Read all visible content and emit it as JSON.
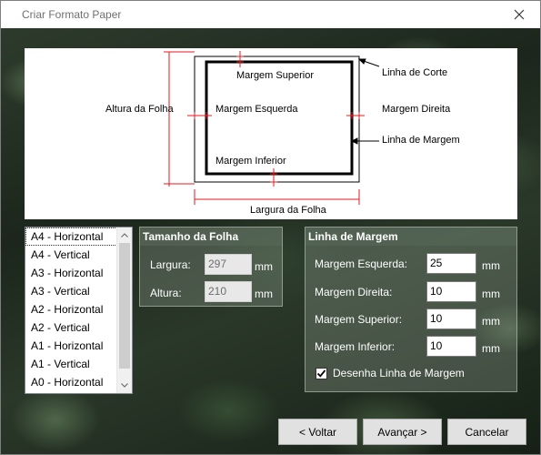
{
  "window": {
    "title": "Criar Formato Paper",
    "close_icon": "close-icon"
  },
  "diagram": {
    "sheet_height_label": "Altura da Folha",
    "sheet_width_label": "Largura da Folha",
    "top_margin_label": "Margem Superior",
    "left_margin_label": "Margem Esquerda",
    "bottom_margin_label": "Margem Inferior",
    "cut_line_label": "Linha de Corte",
    "right_margin_label": "Margem Direita",
    "margin_line_label": "Linha de Margem",
    "line_color": "#e8191f"
  },
  "format_list": {
    "items": [
      {
        "label": "A4 - Horizontal"
      },
      {
        "label": "A4 - Vertical"
      },
      {
        "label": "A3 - Horizontal"
      },
      {
        "label": "A3 - Vertical"
      },
      {
        "label": "A2 - Horizontal"
      },
      {
        "label": "A2 - Vertical"
      },
      {
        "label": "A1 - Horizontal"
      },
      {
        "label": "A1 - Vertical"
      },
      {
        "label": "A0 - Horizontal"
      }
    ],
    "selected": "A4 - Horizontal"
  },
  "sheet_size": {
    "title": "Tamanho da Folha",
    "width_label": "Largura:",
    "width_value": "297",
    "height_label": "Altura:",
    "height_value": "210",
    "unit": "mm"
  },
  "margin_line": {
    "title": "Linha de Margem",
    "left_label": "Margem Esquerda:",
    "left_value": "25",
    "right_label": "Margem Direita:",
    "right_value": "10",
    "top_label": "Margem Superior:",
    "top_value": "10",
    "bottom_label": "Margem Inferior:",
    "bottom_value": "10",
    "unit": "mm",
    "draw_label": "Desenha Linha de Margem",
    "draw_checked": true
  },
  "buttons": {
    "back": "< Voltar",
    "next": "Avançar >",
    "cancel": "Cancelar"
  }
}
